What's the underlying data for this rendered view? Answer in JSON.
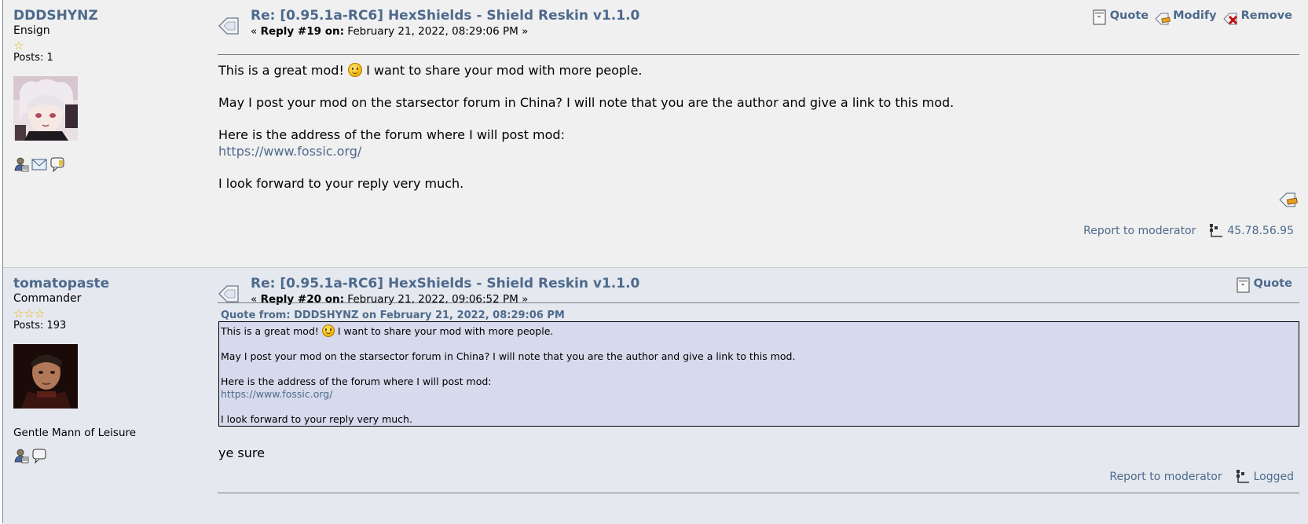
{
  "posts": [
    {
      "author": "DDDSHYNZ",
      "rank": "Ensign",
      "stars": 1,
      "posts_label": "Posts: 1",
      "subject": "Re: [0.95.1a-RC6] HexShields - Shield Reskin v1.1.0",
      "reply_prefix": "«",
      "reply_label": "Reply #19 on:",
      "reply_date": "February 21, 2022, 08:29:06 PM »",
      "buttons": {
        "quote": "Quote",
        "modify": "Modify",
        "remove": "Remove"
      },
      "body": {
        "line1_a": "This is a great mod!",
        "line1_b": "I want to share your mod with more people.",
        "line2": "May I post your mod on the starsector forum in China? I will note that you are the author and give a link to this mod.",
        "line3": "Here is the address of the forum where I will post mod:",
        "link": "https://www.fossic.org/",
        "line4": "I look forward to your reply very much."
      },
      "report": "Report to moderator",
      "ip": "45.78.56.95"
    },
    {
      "author": "tomatopaste",
      "rank": "Commander",
      "stars": 3,
      "posts_label": "Posts: 193",
      "personal_text": "Gentle Mann of Leisure",
      "subject": "Re: [0.95.1a-RC6] HexShields - Shield Reskin v1.1.0",
      "reply_prefix": "«",
      "reply_label": "Reply #20 on:",
      "reply_date": "February 21, 2022, 09:06:52 PM »",
      "buttons": {
        "quote": "Quote"
      },
      "quote_header": "Quote from: DDDSHYNZ on February 21, 2022, 08:29:06 PM",
      "quote": {
        "line1_a": "This is a great mod!",
        "line1_b": "I want to share your mod with more people.",
        "line2": "May I post your mod on the starsector forum in China? I will note that you are the author and give a link to this mod.",
        "line3": "Here is the address of the forum where I will post mod:",
        "link": "https://www.fossic.org/",
        "line4": "I look forward to your reply very much."
      },
      "body": "ye sure",
      "report": "Report to moderator",
      "logged": "Logged"
    }
  ],
  "colors": {
    "link": "#4d6a8c",
    "quote_bg": "#d7daec",
    "post1_bg": "#f0f0f0",
    "post2_bg": "#e5e8ef"
  },
  "icons": [
    "star-icon",
    "profile-icon",
    "email-icon",
    "pm-icon",
    "subject-icon",
    "quote-icon",
    "modify-icon",
    "remove-icon",
    "quick-modify-icon",
    "ip-icon",
    "smiley-icon"
  ]
}
